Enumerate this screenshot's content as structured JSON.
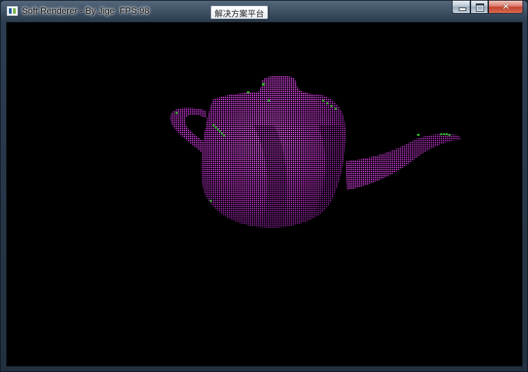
{
  "window": {
    "title": "Soft Renderer - By Jige  FPS:98",
    "tooltip": "解决方案平台",
    "icon": "app-window-icon"
  },
  "caption_buttons": {
    "minimize": "minimize-icon",
    "maximize": "maximize-icon",
    "close": "close-icon"
  },
  "viewport": {
    "background": "#000000",
    "model": "teapot",
    "surface_color": "#c93ed3",
    "shadow_color": "#7a1e86",
    "highlight_color": "#2ea32b"
  }
}
